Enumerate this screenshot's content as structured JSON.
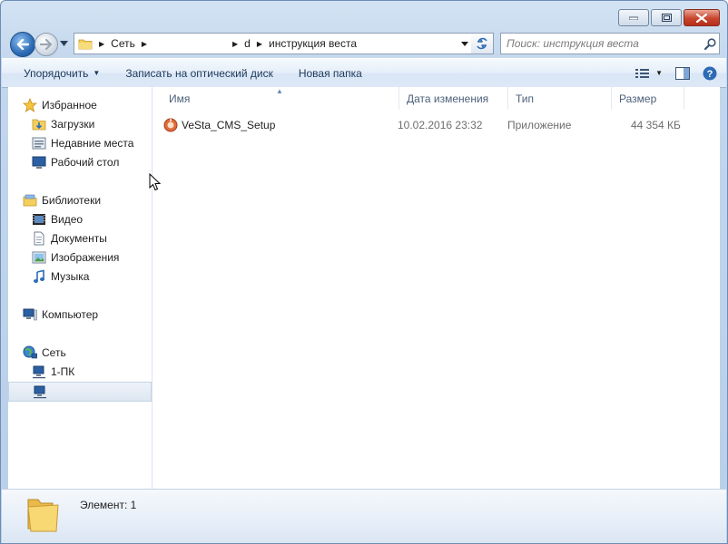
{
  "window": {
    "minimize_glyph": "▁",
    "maximize_glyph": "▢",
    "close_glyph": "✕"
  },
  "address": {
    "crumbs": [
      "Сеть",
      "",
      "d",
      "инструкция веста"
    ]
  },
  "search": {
    "placeholder": "Поиск: инструкция веста"
  },
  "toolbar": {
    "organize_label": "Упорядочить",
    "burn_label": "Записать на оптический диск",
    "new_folder_label": "Новая папка"
  },
  "sidebar": {
    "groups": [
      {
        "label": "Избранное",
        "icon": "star-icon"
      },
      {
        "label": "Загрузки",
        "icon": "downloads-icon"
      },
      {
        "label": "Недавние места",
        "icon": "recent-places-icon"
      },
      {
        "label": "Рабочий стол",
        "icon": "desktop-icon"
      },
      {
        "label": "Библиотеки",
        "icon": "libraries-icon"
      },
      {
        "label": "Видео",
        "icon": "video-icon"
      },
      {
        "label": "Документы",
        "icon": "documents-icon"
      },
      {
        "label": "Изображения",
        "icon": "pictures-icon"
      },
      {
        "label": "Музыка",
        "icon": "music-icon"
      },
      {
        "label": "Компьютер",
        "icon": "computer-icon"
      },
      {
        "label": "Сеть",
        "icon": "network-icon"
      },
      {
        "label": "1-ПК",
        "icon": "network-pc-icon"
      },
      {
        "label": "",
        "icon": "network-pc-icon"
      }
    ]
  },
  "columns": {
    "name": "Имя",
    "date": "Дата изменения",
    "type": "Тип",
    "size": "Размер"
  },
  "files": [
    {
      "name": "VeSta_CMS_Setup",
      "date": "10.02.2016 23:32",
      "type": "Приложение",
      "size": "44 354 КБ",
      "icon": "installer-icon"
    }
  ],
  "status": {
    "items_label": "Элемент: 1"
  },
  "colors": {
    "accent": "#2d6cb5",
    "selection": "#dde6f2"
  }
}
